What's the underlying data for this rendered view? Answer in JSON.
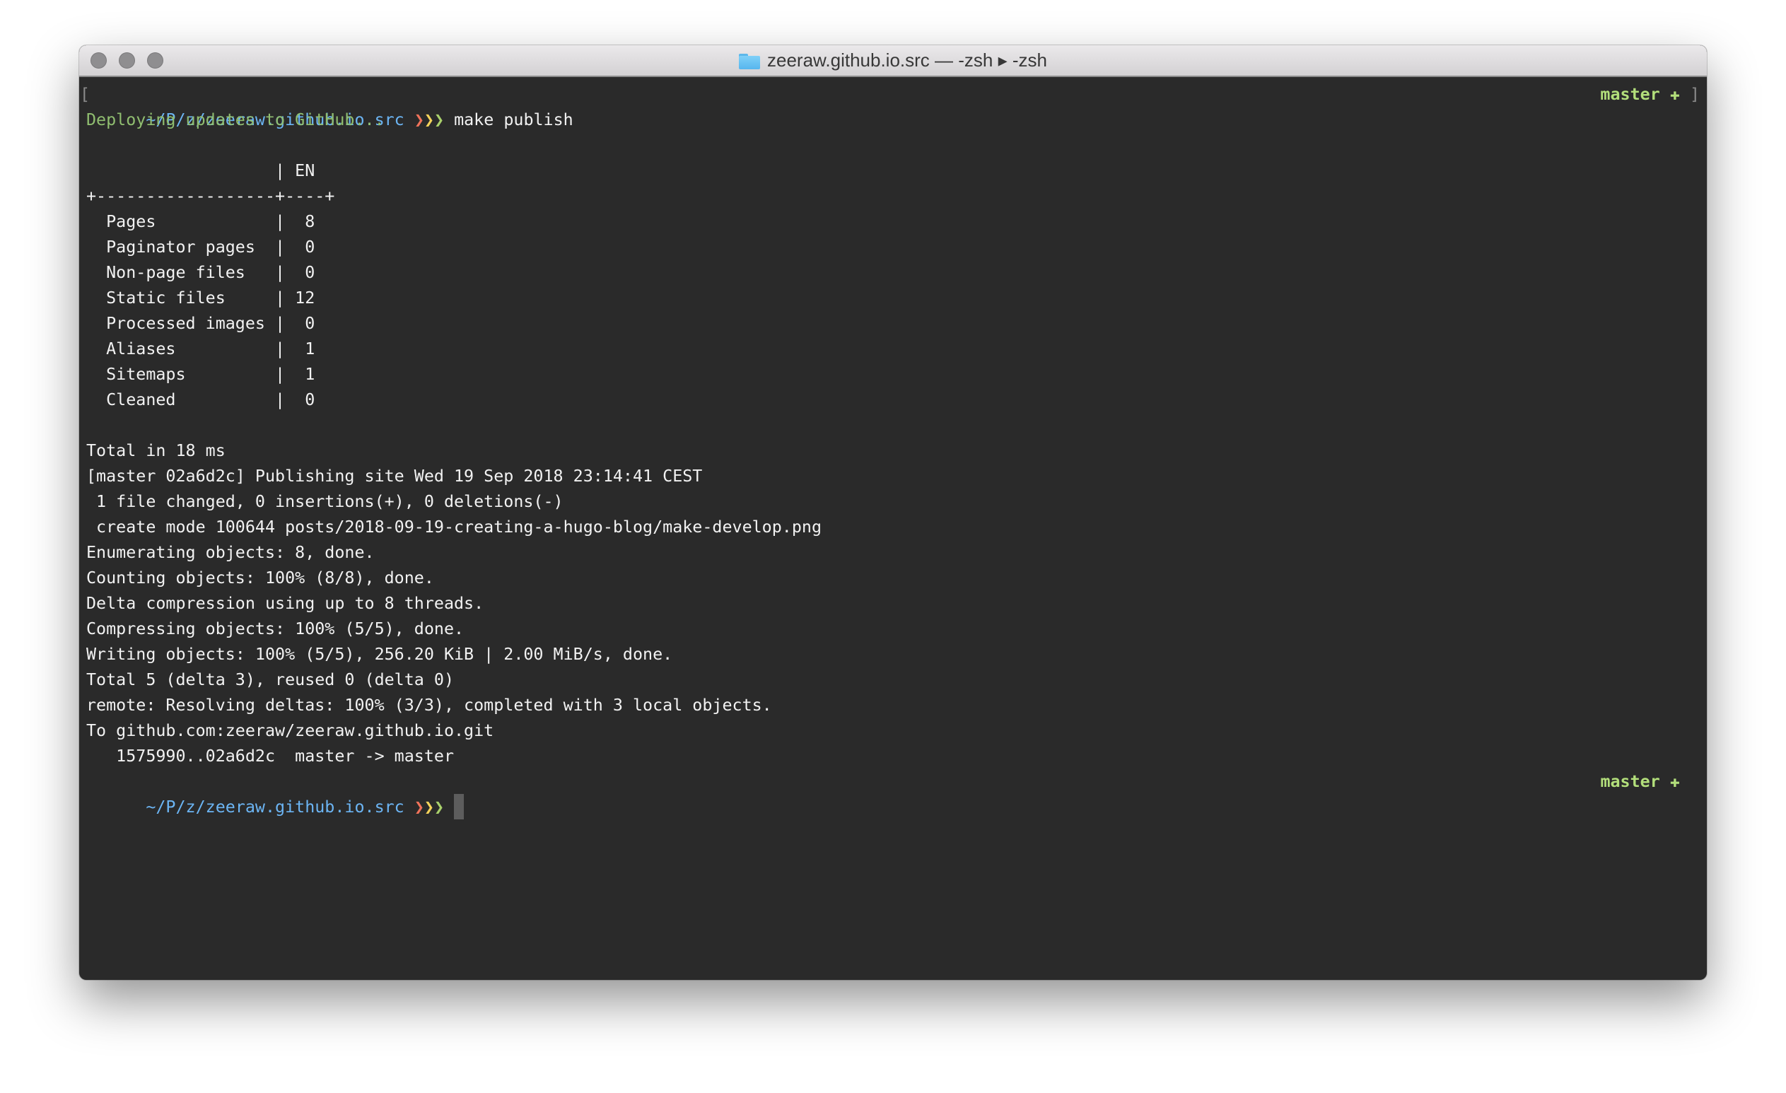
{
  "window": {
    "title": "zeeraw.github.io.src — -zsh ▸ -zsh",
    "traffic_lights": [
      "close",
      "minimize",
      "zoom"
    ]
  },
  "prompt": {
    "path": "~/P/z/zeeraw.github.io.src",
    "arrows": [
      "❯",
      "❯",
      "❯"
    ],
    "branch": "master",
    "branch_status_icon": "✚",
    "open_bracket": "[",
    "close_bracket": "]"
  },
  "colors": {
    "background": "#2a2a2a",
    "path": "#6cb5f4",
    "arrow_1": "#f0725a",
    "arrow_2": "#f4d35a",
    "arrow_3": "#a9d06b",
    "branch": "#b3df7b",
    "info": "#90be70"
  },
  "session": {
    "command": "make publish",
    "deploy_message": "Deploying updates to GitHub...",
    "stats_table": {
      "header": "                   | EN",
      "separator": "+------------------+----+",
      "rows": [
        {
          "text": "  Pages            |  8"
        },
        {
          "text": "  Paginator pages  |  0"
        },
        {
          "text": "  Non-page files   |  0"
        },
        {
          "text": "  Static files     | 12"
        },
        {
          "text": "  Processed images |  0"
        },
        {
          "text": "  Aliases          |  1"
        },
        {
          "text": "  Sitemaps         |  1"
        },
        {
          "text": "  Cleaned          |  0"
        }
      ]
    },
    "output_lines": [
      "Total in 18 ms",
      "[master 02a6d2c] Publishing site Wed 19 Sep 2018 23:14:41 CEST",
      " 1 file changed, 0 insertions(+), 0 deletions(-)",
      " create mode 100644 posts/2018-09-19-creating-a-hugo-blog/make-develop.png",
      "Enumerating objects: 8, done.",
      "Counting objects: 100% (8/8), done.",
      "Delta compression using up to 8 threads.",
      "Compressing objects: 100% (5/5), done.",
      "Writing objects: 100% (5/5), 256.20 KiB | 2.00 MiB/s, done.",
      "Total 5 (delta 3), reused 0 (delta 0)",
      "remote: Resolving deltas: 100% (3/3), completed with 3 local objects.",
      "To github.com:zeeraw/zeeraw.github.io.git",
      "   1575990..02a6d2c  master -> master"
    ]
  }
}
